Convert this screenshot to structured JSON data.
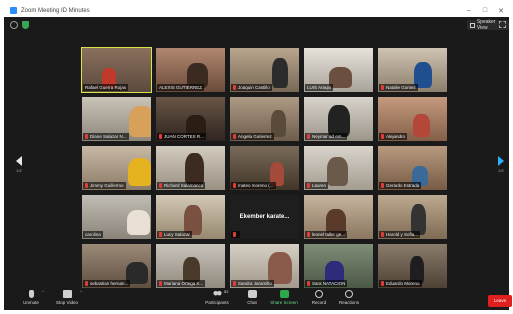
{
  "window": {
    "title": "Zoom Meeting ID Minutes"
  },
  "window_controls": {
    "minimize": "–",
    "maximize": "□",
    "close": "✕"
  },
  "topbar": {
    "speaker_view_label": "Speaker View"
  },
  "pagination": {
    "prev_label": "1/2",
    "next_label": "1/2"
  },
  "participants": [
    {
      "name": "Rafael Guerra Rojas",
      "muted": false,
      "active": true
    },
    {
      "name": "ALEXIS GUTIÉRREZ",
      "muted": false
    },
    {
      "name": "Joaquin Castillo",
      "muted": true
    },
    {
      "name": "LUIS Araujo",
      "muted": false
    },
    {
      "name": "Natalie Gomez",
      "muted": true
    },
    {
      "name": "Diane Salazar N...",
      "muted": true
    },
    {
      "name": "JUAN CORTES R...",
      "muted": true
    },
    {
      "name": "Angela Gutierrez",
      "muted": true
    },
    {
      "name": "Neymar ad em...",
      "muted": true
    },
    {
      "name": "Alejandro",
      "muted": true
    },
    {
      "name": "Jimmy Guillermo",
      "muted": true
    },
    {
      "name": "Richard Salamanca",
      "muted": true
    },
    {
      "name": "mateo moreno (...",
      "muted": true
    },
    {
      "name": "Lauren",
      "muted": true
    },
    {
      "name": "Gerardo Estrada",
      "muted": true
    },
    {
      "name": "carolina",
      "muted": false
    },
    {
      "name": "Lucy Salazar",
      "muted": true
    },
    {
      "name": "Ekember karate...",
      "muted": true,
      "text_only": true
    },
    {
      "name": "leonel taller ge...",
      "muted": true
    },
    {
      "name": "Harold y Sofia...",
      "muted": true
    },
    {
      "name": "sebastian hernan...",
      "muted": true
    },
    {
      "name": "Mariana Ortega K...",
      "muted": true
    },
    {
      "name": "Sandra Jaramillo",
      "muted": true
    },
    {
      "name": "Sara NATACION",
      "muted": true
    },
    {
      "name": "Eduardo Moreno",
      "muted": true
    }
  ],
  "toolbar": {
    "unmute_label": "Unmute",
    "stop_video_label": "Stop Video",
    "participants_label": "Participants",
    "participants_count": "52",
    "chat_label": "Chat",
    "share_label": "Share Screen",
    "record_label": "Record",
    "reactions_label": "Reactions",
    "leave_label": "Leave"
  },
  "icons": [
    "info-icon",
    "shield-icon",
    "grid-icon",
    "fullscreen-icon",
    "mic-icon",
    "video-icon",
    "participants-icon",
    "chat-icon",
    "share-screen-icon",
    "record-icon",
    "reactions-icon"
  ],
  "colors": {
    "background": "#1a1a1a",
    "active_speaker_border": "#d9e34a",
    "leave": "#e0201f",
    "share": "#2ea84a",
    "next_arrow": "#2db0ff"
  }
}
